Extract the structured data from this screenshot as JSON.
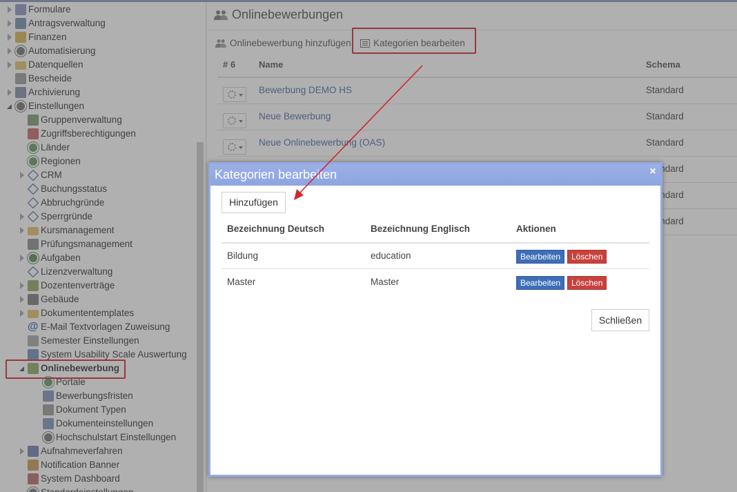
{
  "sidebar": {
    "items": [
      {
        "label": "Formulare",
        "icon": "form-icon",
        "state": "collapsed"
      },
      {
        "label": "Antragsverwaltung",
        "icon": "table-icon",
        "state": "collapsed"
      },
      {
        "label": "Finanzen",
        "icon": "coins-icon",
        "state": "collapsed"
      },
      {
        "label": "Automatisierung",
        "icon": "gear-icon",
        "state": "collapsed"
      },
      {
        "label": "Datenquellen",
        "icon": "folder-icon",
        "state": "collapsed"
      },
      {
        "label": "Bescheide",
        "icon": "document-icon",
        "state": "none"
      },
      {
        "label": "Archivierung",
        "icon": "archive-icon",
        "state": "collapsed"
      },
      {
        "label": "Einstellungen",
        "icon": "gear-icon",
        "state": "expanded"
      },
      {
        "label": "Gruppenverwaltung",
        "icon": "user-icon",
        "state": "none"
      },
      {
        "label": "Zugriffsberechtigungen",
        "icon": "shield-icon",
        "state": "none"
      },
      {
        "label": "Länder",
        "icon": "globe-icon",
        "state": "none"
      },
      {
        "label": "Regionen",
        "icon": "globe-icon",
        "state": "none"
      },
      {
        "label": "CRM",
        "icon": "tag-icon",
        "state": "collapsed"
      },
      {
        "label": "Buchungsstatus",
        "icon": "tag-icon",
        "state": "none"
      },
      {
        "label": "Abbruchgründe",
        "icon": "tag-icon",
        "state": "none"
      },
      {
        "label": "Sperrgründe",
        "icon": "tag-icon",
        "state": "collapsed"
      },
      {
        "label": "Kursmanagement",
        "icon": "folder-icon",
        "state": "collapsed"
      },
      {
        "label": "Prüfungsmanagement",
        "icon": "checklist-icon",
        "state": "none"
      },
      {
        "label": "Aufgaben",
        "icon": "clock-icon",
        "state": "collapsed"
      },
      {
        "label": "Lizenzverwaltung",
        "icon": "tag-icon",
        "state": "none"
      },
      {
        "label": "Dozentenverträge",
        "icon": "people-icon",
        "state": "collapsed"
      },
      {
        "label": "Gebäude",
        "icon": "house-icon",
        "state": "collapsed"
      },
      {
        "label": "Dokumententemplates",
        "icon": "folder-icon",
        "state": "collapsed"
      },
      {
        "label": "E-Mail Textvorlagen Zuweisung",
        "icon": "at-icon",
        "state": "none"
      },
      {
        "label": "Semester Einstellungen",
        "icon": "calendar-icon",
        "state": "none"
      },
      {
        "label": "System Usability Scale Auswertung",
        "icon": "chart-icon",
        "state": "none"
      },
      {
        "label": "Onlinebewerbung",
        "icon": "people-icon",
        "state": "expanded",
        "selected": true
      },
      {
        "label": "Portale",
        "icon": "globe-icon",
        "state": "none"
      },
      {
        "label": "Bewerbungsfristen",
        "icon": "list-icon",
        "state": "none"
      },
      {
        "label": "Dokument Typen",
        "icon": "document-icon",
        "state": "none"
      },
      {
        "label": "Dokumenteinstellungen",
        "icon": "list-icon",
        "state": "none"
      },
      {
        "label": "Hochschulstart Einstellungen",
        "icon": "gear-icon",
        "state": "none"
      },
      {
        "label": "Aufnahmeverfahren",
        "icon": "graduation-icon",
        "state": "collapsed"
      },
      {
        "label": "Notification Banner",
        "icon": "bell-icon",
        "state": "none"
      },
      {
        "label": "System Dashboard",
        "icon": "dashboard-icon",
        "state": "none"
      },
      {
        "label": "Standardeinstellungen",
        "icon": "gear-icon",
        "state": "none"
      }
    ]
  },
  "main": {
    "title": "Onlinebewerbungen",
    "toolbar": {
      "add_label": "Onlinebewerbung hinzufügen",
      "edit_categories_label": "Kategorien bearbeiten"
    },
    "table": {
      "headers": {
        "number": "# 6",
        "name": "Name",
        "schema": "Schema"
      },
      "rows": [
        {
          "name": "Bewerbung DEMO HS",
          "schema": "Standard"
        },
        {
          "name": "Neue Bewerbung",
          "schema": "Standard"
        },
        {
          "name": "Neue Onlinebewerbung (OAS)",
          "schema": "Standard"
        },
        {
          "name": "",
          "schema": "Standard"
        },
        {
          "name": "",
          "schema": "Standard"
        },
        {
          "name": "",
          "schema": "Standard"
        }
      ]
    }
  },
  "modal": {
    "title": "Kategorien bearbeiten",
    "close_glyph": "×",
    "add_label": "Hinzufügen",
    "headers": {
      "de": "Bezeichnung Deutsch",
      "en": "Bezeichnung Englisch",
      "actions": "Aktionen"
    },
    "rows": [
      {
        "de": "Bildung",
        "en": "education",
        "edit": "Bearbeiten",
        "delete": "Löschen"
      },
      {
        "de": "Master",
        "en": "Master",
        "edit": "Bearbeiten",
        "delete": "Löschen"
      }
    ],
    "close_label": "Schließen"
  },
  "colors": {
    "highlight": "#d22630",
    "modal_header": "#95a9e1",
    "edit_button": "#3f6eb8",
    "delete_button": "#c9413c",
    "link": "#4a6fa5"
  }
}
